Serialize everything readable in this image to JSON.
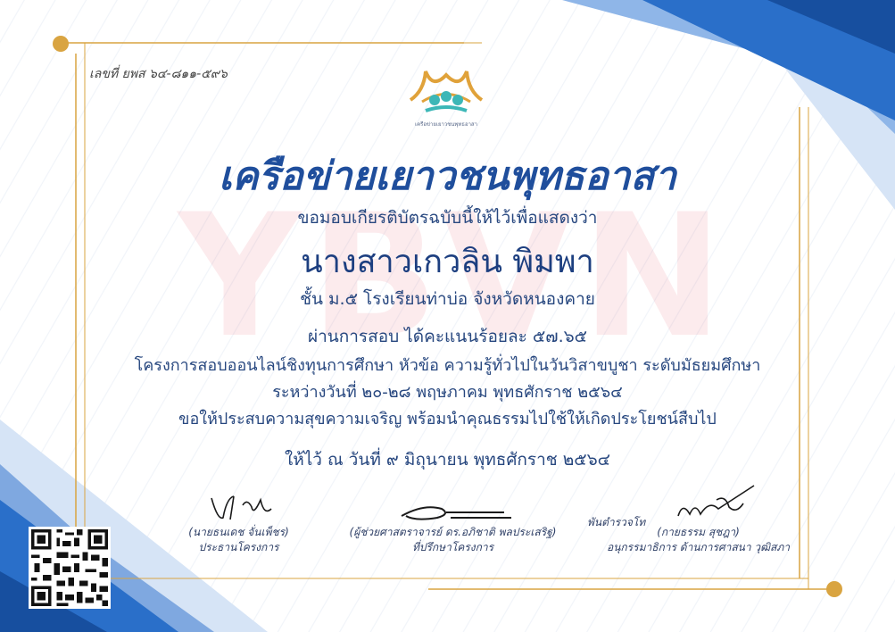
{
  "certificate": {
    "reference_no": "เลขที่  ยพส ๖๔-๘๑๑-๕๙๖",
    "logo_caption": "เครือข่ายเยาวชนพุทธอาสา",
    "title": "เครือข่ายเยาวชนพุทธอาสา",
    "watermark": "YBVN",
    "intro": "ขอมอบเกียรติบัตรฉบับนี้ให้ไว้เพื่อแสดงว่า",
    "recipient_name": "นางสาวเกวลิน  พิมพา",
    "school_line": "ชั้น ม.๕  โรงเรียนท่าบ่อ จังหวัดหนองคาย",
    "score_line": "ผ่านการสอบ  ได้คะแนนร้อยละ ๕๗.๖๕",
    "project_line": "โครงการสอบออนไลน์ชิงทุนการศึกษา หัวข้อ ความรู้ทั่วไปในวันวิสาขบูชา ระดับมัธยมศึกษา",
    "period_line": "ระหว่างวันที่ ๒๐-๒๘ พฤษภาคม พุทธศักราช ๒๕๖๔",
    "wish_line": "ขอให้ประสบความสุขความเจริญ พร้อมนำคุณธรรมไปใช้ให้เกิดประโยชน์สืบไป",
    "issue_date": "ให้ไว้ ณ วันที่ ๙ มิถุนายน พุทธศักราช ๒๕๖๔"
  },
  "signatories": [
    {
      "name": "(นายธนเดช  จั่นเพ็ชร)",
      "position": "ประธานโครงการ"
    },
    {
      "name": "(ผู้ช่วยศาสตราจารย์ ดร.อภิชาติ  พลประเสริฐ)",
      "position": "ที่ปรึกษาโครงการ"
    },
    {
      "prefix": "พันตำรวจโท",
      "name": "(กายธรรม  สุชฎา)",
      "position": "อนุกรรมาธิการ ด้านการศาสนา วุฒิสภา"
    }
  ],
  "colors": {
    "primary_blue": "#1f5fb5",
    "dark_blue": "#1d3f80",
    "gold": "#d9a441",
    "watermark_red": "#e63c50"
  },
  "icons": {
    "logo": "temple-roof-logo",
    "qr": "qr-code-icon"
  }
}
